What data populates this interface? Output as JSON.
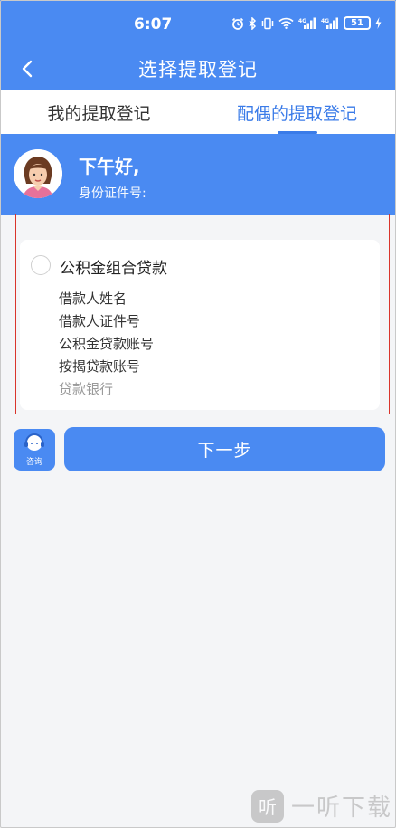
{
  "status_bar": {
    "time": "6:07",
    "battery": "51",
    "icons": [
      "alarm-icon",
      "bluetooth-icon",
      "vibrate-icon",
      "wifi-icon",
      "signal-icon",
      "signal-icon",
      "charging-icon"
    ]
  },
  "nav": {
    "title": "选择提取登记"
  },
  "tabs": [
    {
      "label": "我的提取登记",
      "active": false
    },
    {
      "label": "配偶的提取登记",
      "active": true
    }
  ],
  "greeting": {
    "hello": "下午好,",
    "id_label": "身份证件号:"
  },
  "loan_card": {
    "title": "公积金组合贷款",
    "rows": [
      "借款人姓名",
      "借款人证件号",
      "公积金贷款账号",
      "按揭贷款账号",
      "贷款银行"
    ]
  },
  "consult": {
    "label": "咨询"
  },
  "next_button": {
    "label": "下一步"
  },
  "watermark": {
    "logo_char": "听",
    "text": "一听下载"
  },
  "colors": {
    "primary": "#4a8af2",
    "tab_active": "#3a7be8",
    "highlight_border": "#d9342b",
    "background": "#f4f5f7"
  }
}
